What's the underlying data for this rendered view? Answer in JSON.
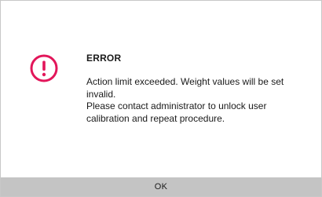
{
  "dialog": {
    "icon": "error-exclamation-icon",
    "accent_color": "#e2165a",
    "title": "ERROR",
    "message_lines": [
      "Action limit exceeded. Weight values will be set",
      "invalid.",
      "Please contact administrator to unlock user",
      "calibration and repeat procedure."
    ],
    "ok_label": "OK"
  }
}
